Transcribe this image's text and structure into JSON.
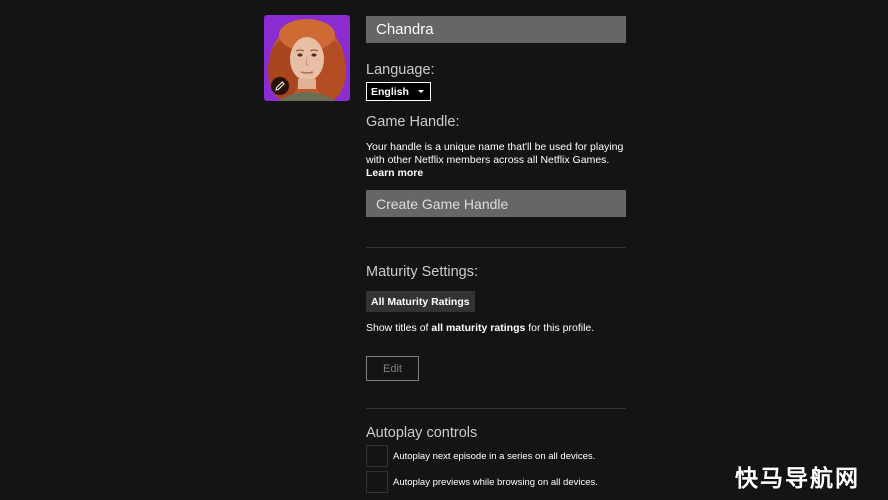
{
  "profile": {
    "name": "Chandra",
    "avatar_icon": "profile-avatar",
    "edit_icon": "pencil-icon"
  },
  "language": {
    "label": "Language:",
    "selected": "English"
  },
  "game_handle": {
    "label": "Game Handle:",
    "description": "Your handle is a unique name that'll be used for playing with other Netflix members across all Netflix Games.",
    "learn_more": "Learn more",
    "placeholder": "Create Game Handle"
  },
  "maturity": {
    "label": "Maturity Settings:",
    "badge": "All Maturity Ratings",
    "desc_prefix": "Show titles of ",
    "desc_bold": "all maturity ratings",
    "desc_suffix": " for this profile.",
    "edit_label": "Edit"
  },
  "autoplay": {
    "label": "Autoplay controls",
    "items": [
      {
        "label": "Autoplay next episode in a series on all devices."
      },
      {
        "label": "Autoplay previews while browsing on all devices."
      }
    ]
  },
  "watermark": "快马导航网",
  "colors": {
    "background": "#141414",
    "input_bg": "#666666",
    "avatar_bg": "#8a2ccf",
    "text": "#ffffff"
  }
}
